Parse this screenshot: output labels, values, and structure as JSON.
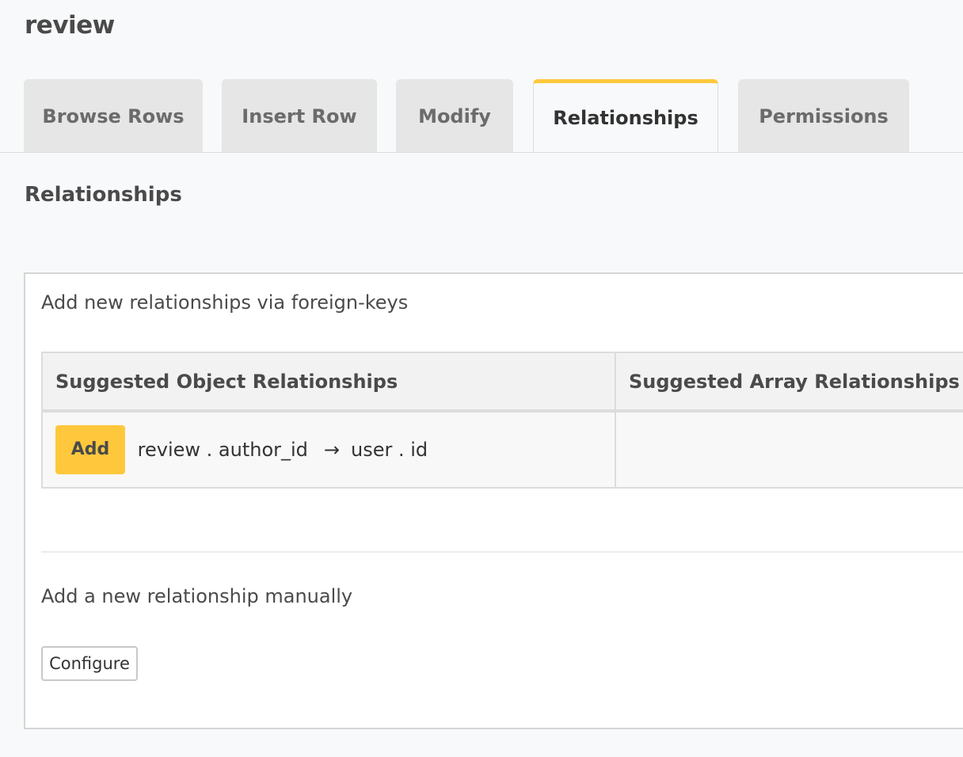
{
  "page": {
    "title": "review"
  },
  "tabs": [
    {
      "label": "Browse Rows",
      "active": false
    },
    {
      "label": "Insert Row",
      "active": false
    },
    {
      "label": "Modify",
      "active": false
    },
    {
      "label": "Relationships",
      "active": true
    },
    {
      "label": "Permissions",
      "active": false
    }
  ],
  "section": {
    "title": "Relationships"
  },
  "foreign_keys": {
    "heading": "Add new relationships via foreign-keys",
    "columns": [
      "Suggested Object Relationships",
      "Suggested Array Relationships"
    ],
    "object_suggestions": [
      {
        "button_label": "Add",
        "from": "review . author_id",
        "arrow": "→",
        "to": "user . id"
      }
    ],
    "array_suggestions": []
  },
  "manual": {
    "heading": "Add a new relationship manually",
    "button_label": "Configure"
  },
  "colors": {
    "accent": "#ffc83c",
    "tab_bg": "#e6e6e6",
    "page_bg": "#f8f9fa"
  }
}
